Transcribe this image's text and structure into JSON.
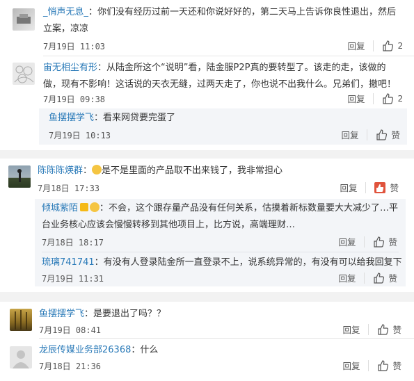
{
  "threads": [
    {
      "user": "_悄声无息_",
      "content": "你们没有经历过前一天还和你说好好的，第二天马上告诉你良性退出，然后立案，凉凉",
      "time": "7月19日 11:03",
      "reply": "回复",
      "likes": "2"
    },
    {
      "user": "宙无相尘有形",
      "content": "从陆金所这个“说明”看，陆金服P2P真的要转型了。该走的走，该做的做，现有不影响！这话说的天衣无缝，过两天走了，你也说不出我什么。兄弟们，撤吧！",
      "time": "7月19日 09:38",
      "reply": "回复",
      "likes": "2",
      "subreply": {
        "user": "鱼摆摆学飞",
        "content": "看来网贷要完蛋了",
        "time": "7月19日 10:13",
        "reply": "回复",
        "like": "赞"
      }
    },
    {
      "user": "陈陈陈煐群",
      "content": "是不是里面的产品取不出来钱了，我非常担心",
      "time": "7月18日 17:33",
      "reply": "回复",
      "like": "赞",
      "subreplies": [
        {
          "user": "倾城紫陌",
          "content": "不会，这个跟存量产品没有任何关系，估摸着新标数量要大大减少了…平台业务核心应该会慢慢转移到其他项目上，比方说，高端理财…",
          "time": "7月18日 18:17",
          "reply": "回复",
          "like": "赞"
        },
        {
          "user": "琉璃741741",
          "content": "有没有人登录陆金所一直登录不上，说系统异常的，有没有可以给我回复下",
          "time": "7月19日 11:31",
          "reply": "回复",
          "like": "赞"
        }
      ]
    },
    {
      "user": "鱼摆摆学飞",
      "content": "是要退出了吗？？",
      "time": "7月19日 08:41",
      "reply": "回复",
      "like": "赞"
    },
    {
      "user": "龙辰传媒业务部26368",
      "content": "什么",
      "time": "7月18日 21:36",
      "reply": "回复",
      "like": "赞"
    }
  ],
  "colors": {
    "username": "#2a7ab8",
    "liked": "#e0533c",
    "background": "#ffffff",
    "subreply_bg": "#f3f5f8",
    "gap": "#f2f2f2"
  },
  "icons": [
    "thumbs-up-icon",
    "crying-emoji-icon",
    "vip-badge-icon"
  ]
}
